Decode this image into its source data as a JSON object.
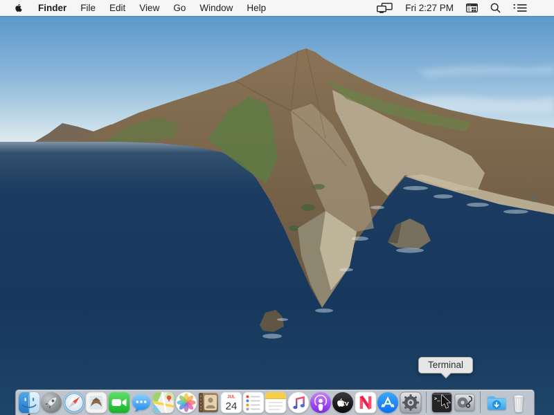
{
  "menubar": {
    "apple_icon": "apple-logo",
    "items": [
      {
        "label": "Finder",
        "bold": true
      },
      {
        "label": "File"
      },
      {
        "label": "Edit"
      },
      {
        "label": "View"
      },
      {
        "label": "Go"
      },
      {
        "label": "Window"
      },
      {
        "label": "Help"
      }
    ],
    "status": {
      "screen_mirroring_icon": "screen-mirroring",
      "clock": "Fri 2:27 PM",
      "keyboard_viewer_icon": "keyboard-viewer",
      "spotlight_icon": "spotlight-search",
      "notification_icon": "notification-list"
    }
  },
  "tooltip": {
    "text": "Terminal"
  },
  "dock": {
    "calendar": {
      "month": "JUL",
      "day": "24"
    },
    "tv_label": "tv",
    "terminal_prompt": ">_",
    "items": [
      {
        "icon": "finder",
        "running": true
      },
      {
        "icon": "launchpad"
      },
      {
        "icon": "safari"
      },
      {
        "icon": "mail"
      },
      {
        "icon": "facetime"
      },
      {
        "icon": "messages"
      },
      {
        "icon": "maps"
      },
      {
        "icon": "photos"
      },
      {
        "icon": "contacts"
      },
      {
        "icon": "calendar"
      },
      {
        "icon": "reminders"
      },
      {
        "icon": "notes"
      },
      {
        "icon": "music"
      },
      {
        "icon": "podcasts"
      },
      {
        "icon": "tv"
      },
      {
        "icon": "news"
      },
      {
        "icon": "appstore"
      },
      {
        "icon": "settings"
      },
      {
        "divider": true
      },
      {
        "icon": "terminal",
        "hovered": true
      },
      {
        "icon": "diskutility"
      },
      {
        "divider": true
      },
      {
        "icon": "downloads"
      },
      {
        "icon": "trash"
      }
    ]
  },
  "wallpaper": {
    "name": "catalina-island",
    "colors": {
      "sky_top": "#4f90c8",
      "sky_horizon": "#d8e8ef",
      "ocean_deep": "#16395e",
      "ocean_bottom": "#1e4569",
      "island_brown": "#8a7355",
      "island_green": "#5e7b43",
      "cliff_light": "#b5aa90"
    }
  }
}
